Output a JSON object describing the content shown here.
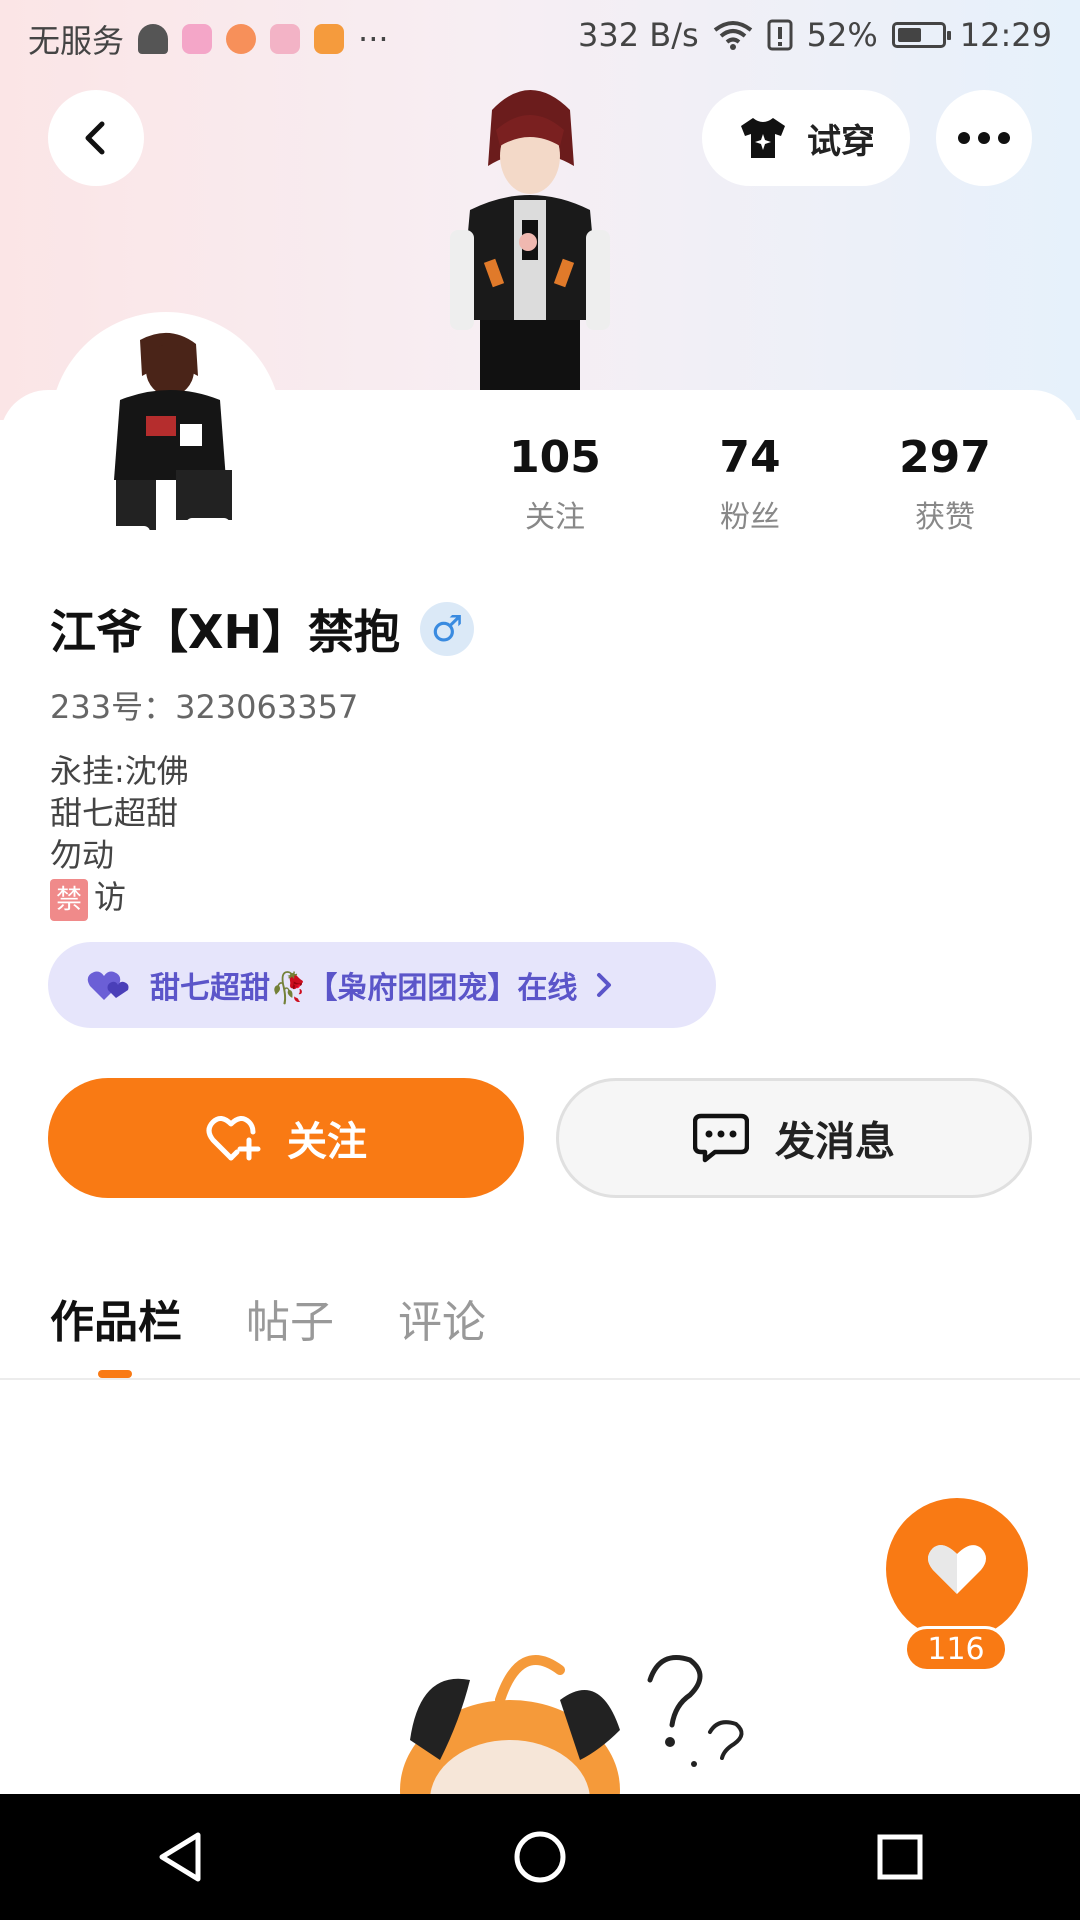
{
  "status_bar": {
    "carrier": "无服务",
    "more": "···",
    "net_speed": "332 B/s",
    "battery": "52%",
    "time": "12:29"
  },
  "header": {
    "tryon_label": "试穿"
  },
  "stats": [
    {
      "value": "105",
      "label": "关注"
    },
    {
      "value": "74",
      "label": "粉丝"
    },
    {
      "value": "297",
      "label": "获赞"
    }
  ],
  "profile": {
    "name": "江爷【XH】禁抱",
    "gender_symbol": "♂",
    "uid": "233号：323063357",
    "bio_lines": [
      "永挂:沈佛",
      "甜七超甜",
      "勿动"
    ],
    "bio_last_tag": "禁",
    "bio_last_text": "访"
  },
  "group": {
    "label": "甜七超甜🥀【枭府团团宠】在线"
  },
  "actions": {
    "follow_label": "关注",
    "message_label": "发消息"
  },
  "tabs": [
    "作品栏",
    "帖子",
    "评论"
  ],
  "like": {
    "count": "116"
  },
  "colors": {
    "accent": "#f97a14",
    "group_bg": "#e6e5fb",
    "group_text": "#5b55c9"
  }
}
